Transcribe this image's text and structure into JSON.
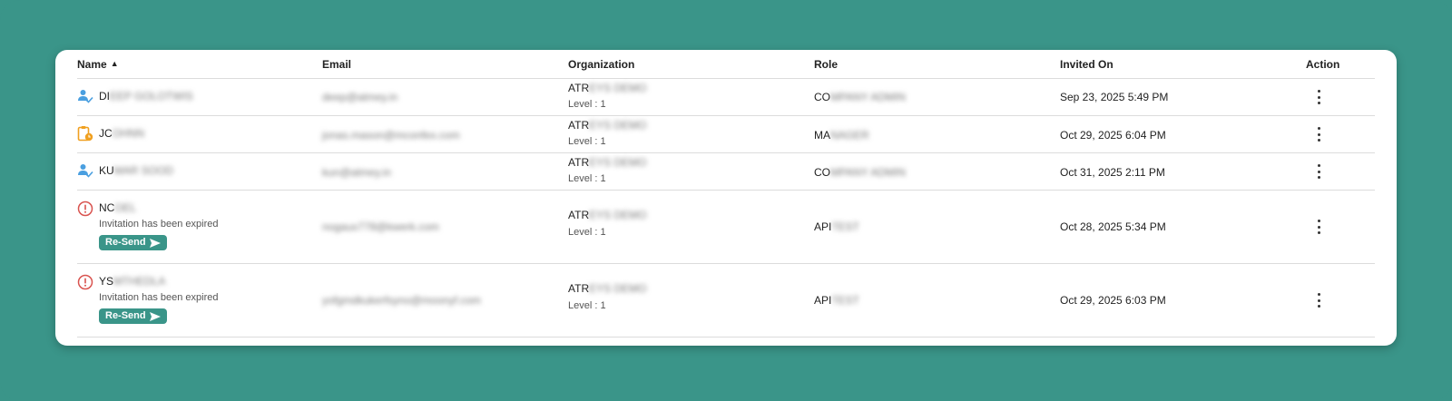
{
  "table": {
    "columns": {
      "name": "Name",
      "email": "Email",
      "organization": "Organization",
      "role": "Role",
      "invited_on": "Invited On",
      "action": "Action"
    },
    "rows": [
      {
        "status": "active",
        "icon": "user-check-icon",
        "name": "DI",
        "name_hidden": "EEP GOLOTWIS",
        "email_hidden": "deep@atmey.in",
        "org": "ATR",
        "org_hidden": "EYS DEMO",
        "level": "Level : 1",
        "role": "CO",
        "role_hidden": "MPANY ADMIN",
        "invited_on": "Sep 23, 2025 5:49 PM"
      },
      {
        "status": "pending",
        "icon": "clipboard-clock-icon",
        "name": "JC",
        "name_hidden": "OHNN",
        "email_hidden": "jonas.mason@mconfex.com",
        "org": "ATR",
        "org_hidden": "EYS DEMO",
        "level": "Level : 1",
        "role": "MA",
        "role_hidden": "NAGER",
        "invited_on": "Oct 29, 2025 6:04 PM"
      },
      {
        "status": "active",
        "icon": "user-check-icon",
        "name": "KU",
        "name_hidden": "MAR SOOD",
        "email_hidden": "kun@atmey.in",
        "org": "ATR",
        "org_hidden": "EYS DEMO",
        "level": "Level : 1",
        "role": "CO",
        "role_hidden": "MPANY ADMIN",
        "invited_on": "Oct 31, 2025 2:11 PM"
      },
      {
        "status": "expired",
        "icon": "alert-circle-icon",
        "name": "NC",
        "name_hidden": "OEL",
        "expired_text": "Invitation has been expired",
        "resend_label": "Re-Send",
        "email_hidden": "nogaux778@kwerk.com",
        "org": "ATR",
        "org_hidden": "EYS DEMO",
        "level": "Level : 1",
        "role": "API",
        "role_hidden": "TEST",
        "invited_on": "Oct 28, 2025 5:34 PM"
      },
      {
        "status": "expired",
        "icon": "alert-circle-icon",
        "name": "YS",
        "name_hidden": "MTHEDLA",
        "expired_text": "Invitation has been expired",
        "resend_label": "Re-Send",
        "email_hidden": "yofgmdkukerfsyno@moonyf.com",
        "org": "ATR",
        "org_hidden": "EYS DEMO",
        "level": "Level : 1",
        "role": "API",
        "role_hidden": "TEST",
        "invited_on": "Oct 29, 2025 6:03 PM"
      }
    ]
  },
  "colors": {
    "background": "#3a9589",
    "accent": "#3a9589",
    "active_icon": "#4a9fe0",
    "pending_icon": "#f0a020",
    "expired_icon": "#d9534f"
  }
}
